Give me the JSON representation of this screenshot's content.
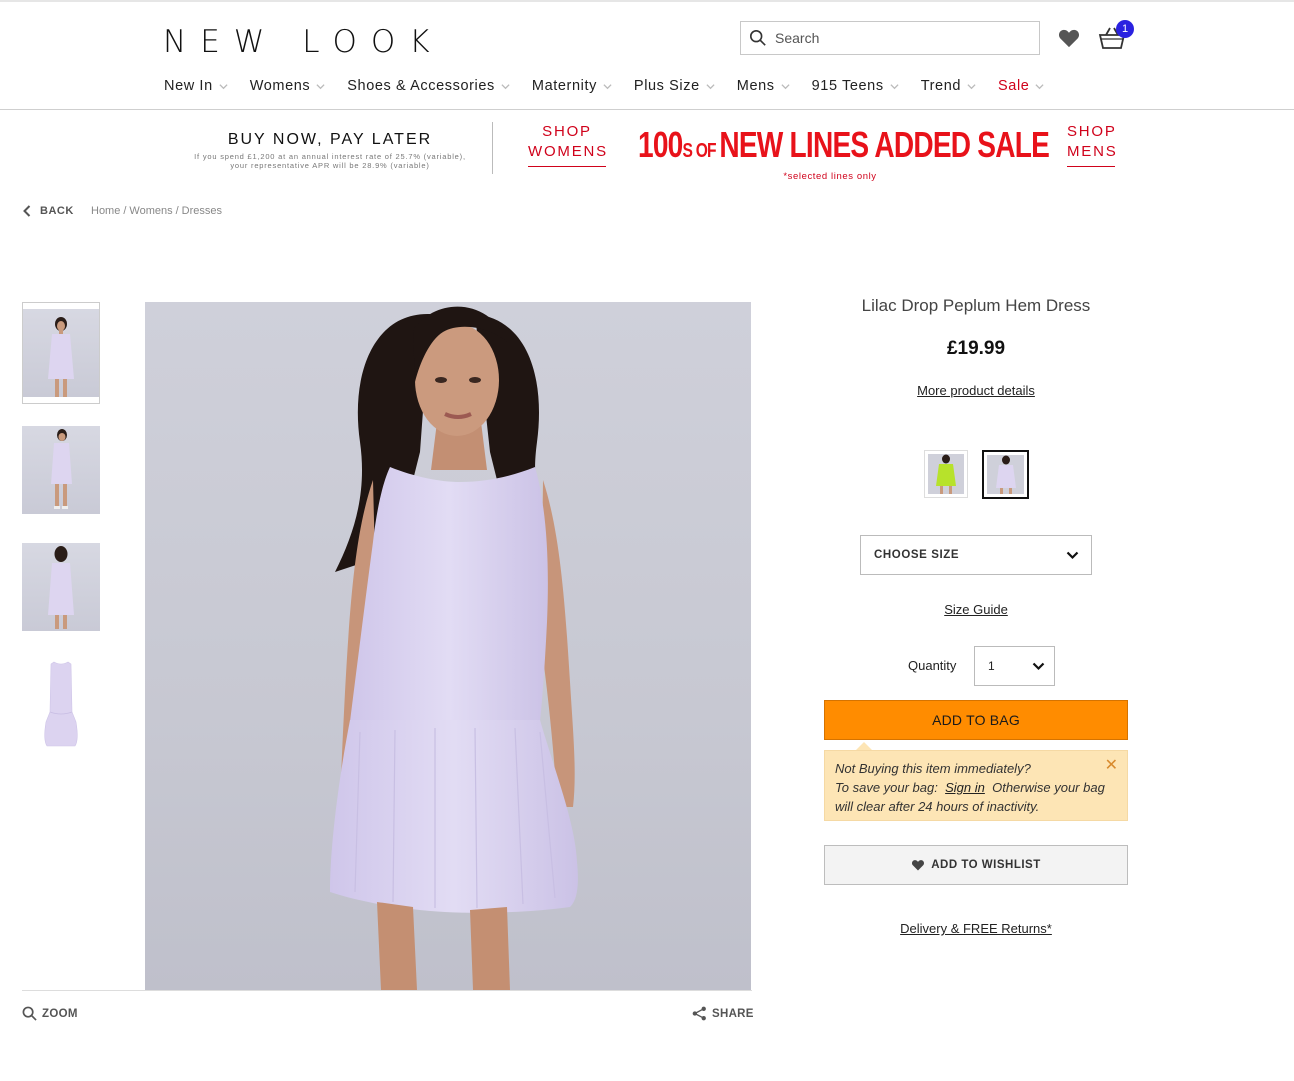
{
  "brand": {
    "logo_text": "NEW LOOK"
  },
  "header": {
    "search_placeholder": "Search",
    "bag_count": "1"
  },
  "nav": [
    {
      "label": "New In"
    },
    {
      "label": "Womens"
    },
    {
      "label": "Shoes & Accessories"
    },
    {
      "label": "Maternity"
    },
    {
      "label": "Plus Size"
    },
    {
      "label": "Mens"
    },
    {
      "label": "915 Teens"
    },
    {
      "label": "Trend"
    },
    {
      "label": "Sale"
    }
  ],
  "promo": {
    "title": "BUY NOW, PAY LATER",
    "sub_line1": "If you spend £1,200 at an annual interest rate of 25.7% (variable),",
    "sub_line2": "your representative APR will be 28.9% (variable)",
    "shop_womens_1": "SHOP",
    "shop_womens_2": "WOMENS",
    "sale_big_1": "100",
    "sale_small": "S OF ",
    "sale_big_2": "NEW LINES ADDED SALE",
    "sale_note": "*selected lines only",
    "shop_mens_1": "SHOP",
    "shop_mens_2": "MENS"
  },
  "breadcrumb": {
    "back": "BACK",
    "items": [
      "Home",
      "/",
      "Womens",
      "/",
      "Dresses"
    ]
  },
  "gallery": {
    "zoom": "ZOOM",
    "share": "SHARE"
  },
  "product": {
    "name": "Lilac Drop Peplum Hem Dress",
    "price": "£19.99",
    "more_details": "More product details",
    "size_select": "CHOOSE SIZE",
    "size_guide": "Size Guide",
    "quantity_label": "Quantity",
    "quantity_value": "1",
    "add_to_bag": "ADD TO BAG",
    "notice_line1": "Not Buying this item immediately?",
    "notice_line2a": "To save your bag:",
    "notice_sign_in": "Sign in",
    "notice_line2b": "Otherwise your bag",
    "notice_line3": "will clear after 24 hours of inactivity.",
    "notice_close": "✕",
    "add_to_wishlist": "ADD TO WISHLIST",
    "delivery": "Delivery & FREE Returns*"
  },
  "colors": {
    "sale_red": "#d0021b",
    "add_to_bag": "#ff8c00",
    "notice_bg": "#fde5b5",
    "badge": "#2a22e0"
  }
}
